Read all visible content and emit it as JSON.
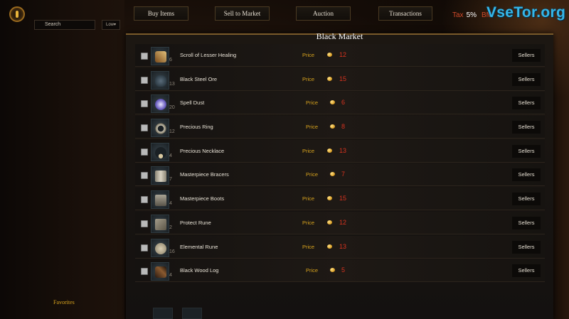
{
  "header": {
    "search_label": "Search",
    "sort_value": "Low",
    "tabs": [
      "Buy Items",
      "Sell to Market",
      "Auction",
      "Transactions"
    ],
    "tax_label": "Tax",
    "tax_value": "5%",
    "bm_label": "BM"
  },
  "watermark": "VseTor.org",
  "market": {
    "title": "Black Market",
    "price_label": "Price",
    "sellers_label": "Sellers",
    "items": [
      {
        "name": "Scroll of Lesser Healing",
        "qty": "6",
        "price": "12",
        "icon": "scroll-icon"
      },
      {
        "name": "Black Steel Ore",
        "qty": "13",
        "price": "15",
        "icon": "ore-icon"
      },
      {
        "name": "Spell Dust",
        "qty": "20",
        "price": "6",
        "icon": "dust-icon"
      },
      {
        "name": "Precious Ring",
        "qty": "12",
        "price": "8",
        "icon": "ring-icon"
      },
      {
        "name": "Precious Necklace",
        "qty": "4",
        "price": "13",
        "icon": "necklace-icon"
      },
      {
        "name": "Masterpiece Bracers",
        "qty": "7",
        "price": "7",
        "icon": "bracers-icon"
      },
      {
        "name": "Masterpiece Boots",
        "qty": "4",
        "price": "15",
        "icon": "boots-icon"
      },
      {
        "name": "Protect Rune",
        "qty": "2",
        "price": "12",
        "icon": "rune-icon"
      },
      {
        "name": "Elemental Rune",
        "qty": "16",
        "price": "13",
        "icon": "elemental-rune-icon"
      },
      {
        "name": "Black Wood Log",
        "qty": "4",
        "price": "5",
        "icon": "log-icon"
      }
    ]
  },
  "sidebar": {
    "favorites_label": "Favorites"
  },
  "colors": {
    "accent_gold": "#d6a21e",
    "price_red": "#d8331f",
    "tax_red": "#d24a2a",
    "watermark_blue": "#35b6e8"
  }
}
